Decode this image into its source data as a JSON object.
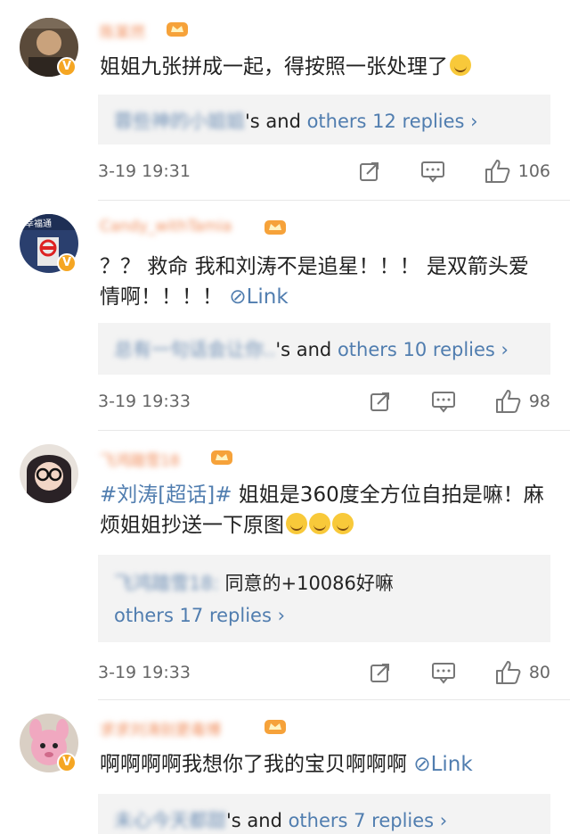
{
  "colors": {
    "link": "#507daf",
    "username": "#f08c5a",
    "badge": "#f5a623",
    "reply_bg": "#f3f3f3"
  },
  "comments": [
    {
      "username": "陈某然",
      "text": "姐姐九张拼成一起，得按照一张处理了",
      "reply_user": "蓉些神的小姐姐",
      "reply_suffix": "'s and ",
      "reply_link": "others 12 replies ›",
      "time": "3-19 19:31",
      "likes": "106"
    },
    {
      "username": "Candy_withTamia",
      "text": "？？ 救命 我和刘涛不是追星！！！ 是双箭头爱情啊！！！！",
      "link": "⊘Link",
      "reply_user": "总有一句话会让你..",
      "reply_suffix": "'s and ",
      "reply_link": "others 10 replies ›",
      "time": "3-19 19:33",
      "likes": "98"
    },
    {
      "username": "飞鸿踏雪18",
      "topic": "#刘涛[超话]#",
      "text": " 姐姐是360度全方位自拍是嘛！麻烦姐姐抄送一下原图",
      "reply_user": "飞鸿踏雪18:",
      "reply_text": "同意的+10086好嘛",
      "reply_link": "others 17 replies ›",
      "time": "3-19 19:33",
      "likes": "80"
    },
    {
      "username": "求求刘涛别更毒博",
      "text": "啊啊啊啊我想你了我的宝贝啊啊啊",
      "link": "⊘Link",
      "reply_user": "未心今天都甜",
      "reply_suffix": "'s and ",
      "reply_link": "others 7 replies ›"
    }
  ]
}
